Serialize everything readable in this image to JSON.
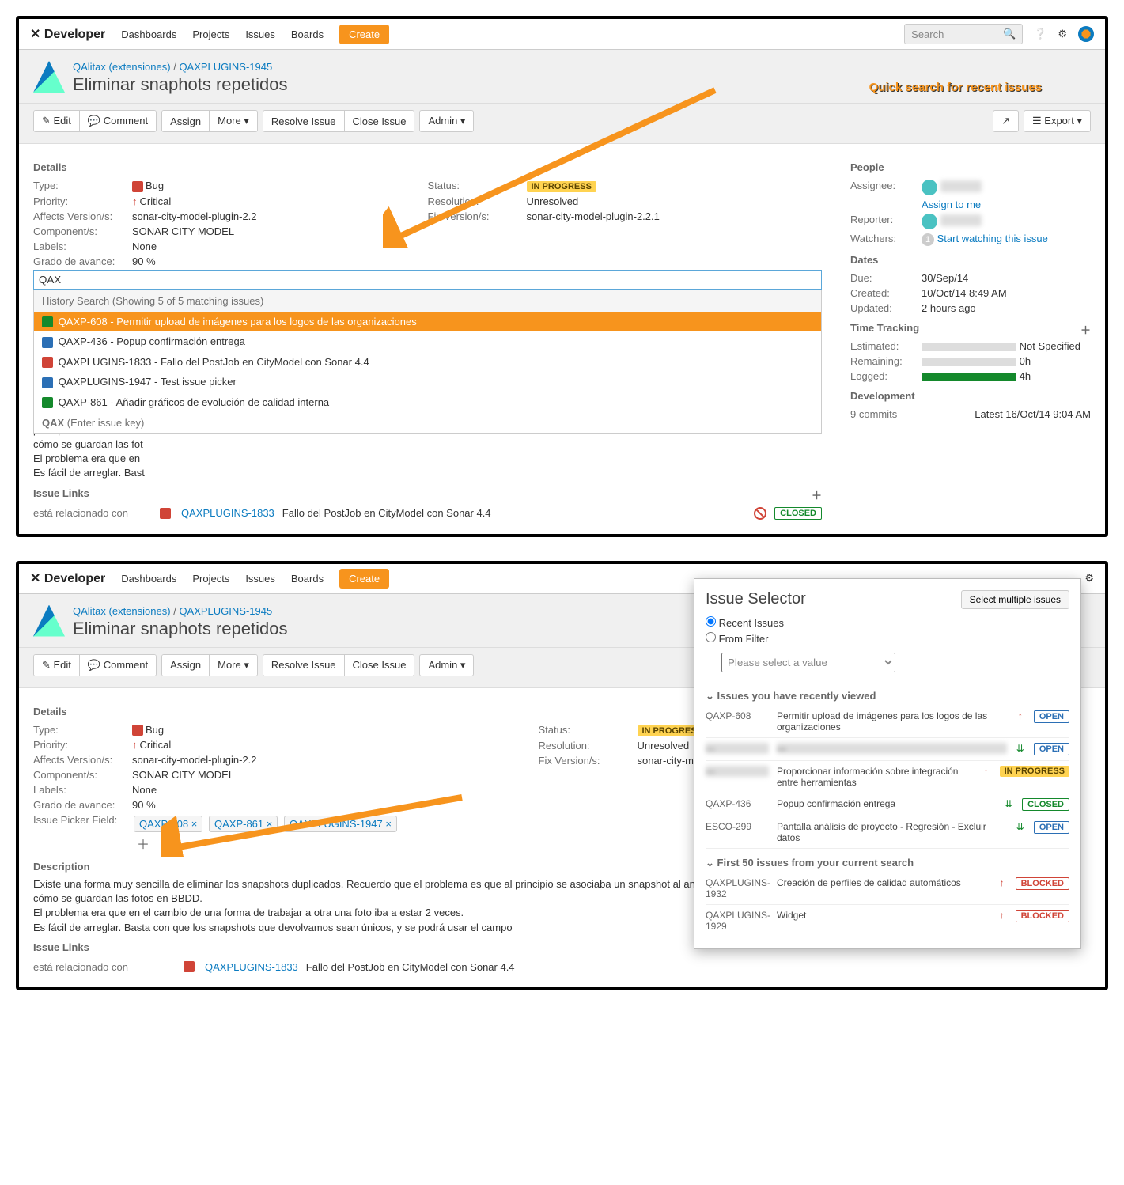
{
  "nav": {
    "brand": "Developer",
    "items": [
      "Dashboards",
      "Projects",
      "Issues",
      "Boards"
    ],
    "create": "Create",
    "search_placeholder": "Search"
  },
  "breadcrumb": {
    "project": "QAlitax (extensiones)",
    "key": "QAXPLUGINS-1945"
  },
  "title": "Eliminar snaphots repetidos",
  "toolbar": {
    "edit": "✎ Edit",
    "comment": "Comment",
    "assign": "Assign",
    "more": "More ▾",
    "resolve": "Resolve Issue",
    "close": "Close Issue",
    "admin": "Admin ▾",
    "export": "Export ▾"
  },
  "sections": {
    "details": "Details",
    "description": "Description",
    "links": "Issue Links",
    "people": "People",
    "dates": "Dates",
    "tracking": "Time Tracking",
    "dev": "Development"
  },
  "details": {
    "type_l": "Type:",
    "type_v": "Bug",
    "prio_l": "Priority:",
    "prio_v": "Critical",
    "aff_l": "Affects Version/s:",
    "aff_v": "sonar-city-model-plugin-2.2",
    "comp_l": "Component/s:",
    "comp_v": "SONAR CITY MODEL",
    "lbl_l": "Labels:",
    "lbl_v": "None",
    "grado_l": "Grado de avance:",
    "grado_v": "90 %",
    "picker_l": "Issue Picker Field:",
    "status_l": "Status:",
    "status_v": "IN PROGRESS",
    "res_l": "Resolution:",
    "res_v": "Unresolved",
    "fix_l": "Fix Version/s:",
    "fix_v": "sonar-city-model-plugin-2.2.1"
  },
  "picker": {
    "query": "QAX",
    "header": "History Search (Showing 5 of 5 matching issues)",
    "items": [
      {
        "ico": "imp",
        "text": "QAXP-608 - Permitir upload de imágenes para los logos de las organizaciones",
        "sel": true
      },
      {
        "ico": "task",
        "text": "QAXP-436 - Popup confirmación entrega"
      },
      {
        "ico": "bug",
        "text": "QAXPLUGINS-1833 - Fallo del PostJob en CityModel con Sonar 4.4"
      },
      {
        "ico": "task",
        "text": "QAXPLUGINS-1947 - Test issue picker"
      },
      {
        "ico": "imp",
        "text": "QAXP-861 - Añadir gráficos de evolución de calidad interna"
      }
    ],
    "footer_key": "QAX",
    "footer_hint": "(Enter issue key)"
  },
  "desc1": "Existe una forma muy sencilla de eliminar los snapshots duplicados. Recuerdo que el problema es que al principio se asociaba un snapshot al análisis actual pero luego tuvo que asociarse al análisis posterior. Eso es cómo se guardan las fotos en BBDD.\nEl problema era que en el cambio de una forma de trabajar a otra una foto iba a estar 2 veces.\nEs fácil de arreglar. Basta con que los snapshots que devolvamos sean únicos, y se podrá usar el campo",
  "desc1_short": [
    "Existe una forma muy se",
    "principio se asociaba una",
    "cómo se guardan las fot",
    "El problema era que en",
    "Es fácil de arreglar. Bast"
  ],
  "links": {
    "rel": "está relacionado con",
    "key": "QAXPLUGINS-1833",
    "summary": "Fallo del PostJob en CityModel con Sonar 4.4",
    "status": "CLOSED"
  },
  "people": {
    "assignee_l": "Assignee:",
    "assign_me": "Assign to me",
    "reporter_l": "Reporter:",
    "watchers_l": "Watchers:",
    "watch_count": "1",
    "watch_action": "Start watching this issue"
  },
  "dates": {
    "due_l": "Due:",
    "due_v": "30/Sep/14",
    "created_l": "Created:",
    "created_v": "10/Oct/14 8:49 AM",
    "updated_l": "Updated:",
    "updated_v": "2 hours ago"
  },
  "tracking": {
    "est_l": "Estimated:",
    "est_v": "Not Specified",
    "rem_l": "Remaining:",
    "rem_v": "0h",
    "log_l": "Logged:",
    "log_v": "4h"
  },
  "dev": {
    "commits_l": "9 commits",
    "latest": "Latest 16/Oct/14 9:04 AM"
  },
  "annotation": "Quick search for recent issues",
  "chips": [
    "QAXP-608 ×",
    "QAXP-861 ×",
    "QAXPLUGINS-1947 ×"
  ],
  "selector": {
    "title": "Issue Selector",
    "multi_btn": "Select multiple issues",
    "radio_recent": "Recent Issues",
    "radio_filter": "From Filter",
    "filter_placeholder": "Please select a value",
    "hdr_recent": "Issues you have recently viewed",
    "hdr_search": "First 50 issues from your current search",
    "recent": [
      {
        "key": "QAXP-608",
        "summary": "Permitir upload de imágenes para los logos de las organizaciones",
        "pr": "up",
        "status": "OPEN"
      },
      {
        "key": "—",
        "summary": "—",
        "pr": "down",
        "status": "OPEN",
        "blur": true
      },
      {
        "key": "—",
        "summary": "Proporcionar información sobre integración entre herramientas",
        "pr": "up",
        "status": "IN PROGRESS",
        "blurkey": true
      },
      {
        "key": "QAXP-436",
        "summary": "Popup confirmación entrega",
        "pr": "down",
        "status": "CLOSED"
      },
      {
        "key": "ESCO-299",
        "summary": "Pantalla análisis de proyecto - Regresión - Excluir datos",
        "pr": "down",
        "status": "OPEN"
      }
    ],
    "search": [
      {
        "key": "QAXPLUGINS-1932",
        "summary": "Creación de perfiles de calidad automáticos",
        "pr": "up",
        "status": "BLOCKED"
      },
      {
        "key": "QAXPLUGINS-1929",
        "summary": "Widget",
        "pr": "up",
        "status": "BLOCKED"
      }
    ]
  }
}
